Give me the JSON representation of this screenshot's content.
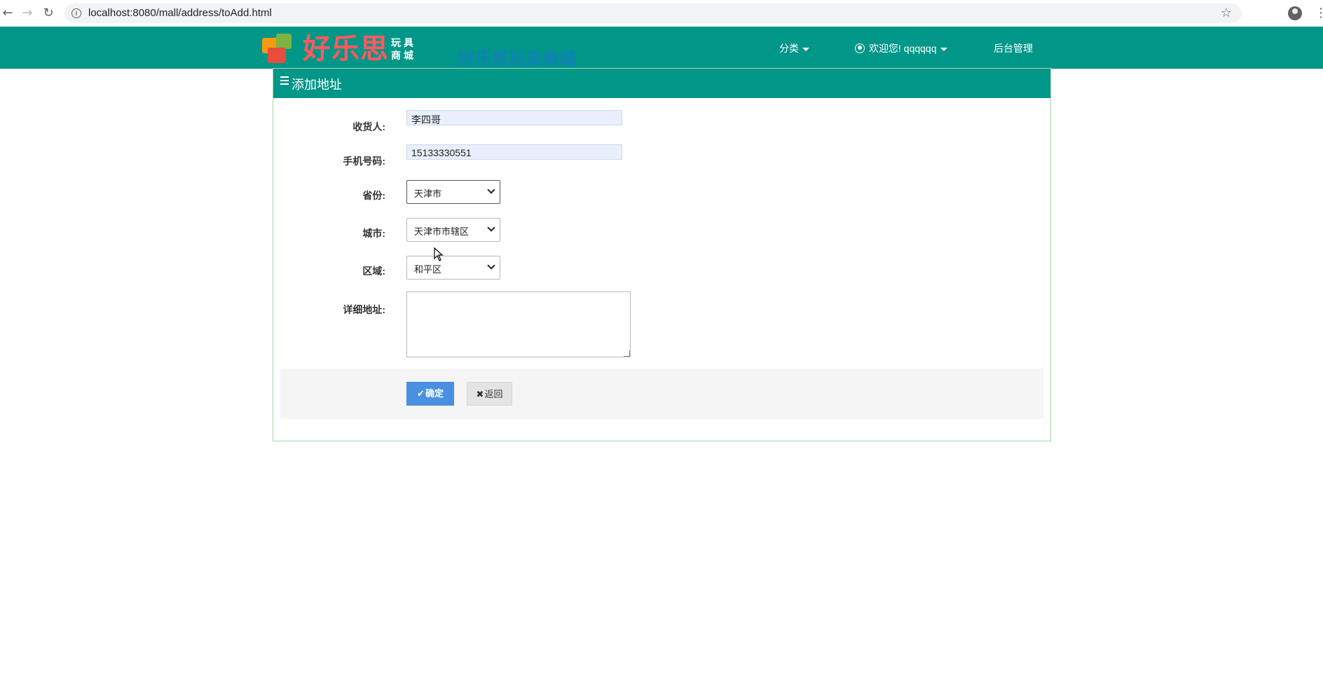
{
  "browser": {
    "url": "localhost:8080/mall/address/toAdd.html",
    "back_glyph": "←",
    "forward_glyph": "→",
    "reload_glyph": "↻",
    "star_glyph": "☆",
    "menu_glyph": "⋮"
  },
  "header": {
    "logo_name": "好乐思",
    "logo_sub": "玩具商城",
    "slogan": "好乐思玩具商城",
    "nav": {
      "category": "分类",
      "user": "欢迎您! qqqqqq",
      "admin": "后台管理"
    }
  },
  "panel": {
    "title": "添加地址"
  },
  "form": {
    "receiver_label": "收货人:",
    "receiver_value": "李四哥",
    "phone_label": "手机号码:",
    "phone_value": "15133330551",
    "province_label": "省份:",
    "province_value": "天津市",
    "city_label": "城市:",
    "city_value": "天津市市辖区",
    "district_label": "区域:",
    "district_value": "和平区",
    "detail_label": "详细地址:",
    "detail_value": ""
  },
  "actions": {
    "confirm_label": "确定",
    "back_label": "返回"
  },
  "colors": {
    "header_bg": "#009688",
    "confirm_bg": "#4a90e2",
    "logo_text": "#ff5a5f"
  }
}
